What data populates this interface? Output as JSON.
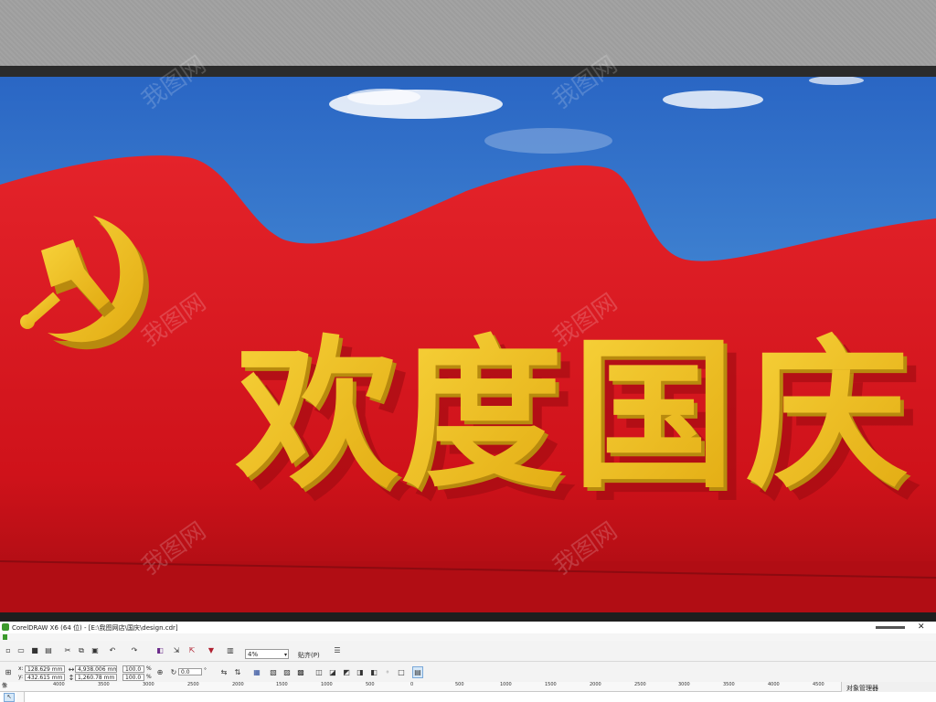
{
  "artwork": {
    "headline": [
      "欢",
      "度",
      "国",
      "庆"
    ],
    "emblem_icon": "hammer-and-sickle-icon",
    "colors": {
      "sky": "#3a7fd0",
      "banner_red": "#d3121b",
      "gold": "#f2c21e",
      "gold_shadow": "#b88a0e"
    }
  },
  "watermark": {
    "text": "我图网"
  },
  "app": {
    "window_title": "CorelDRAW X6 (64 位) - [E:\\我图网店\\国庆\\design.cdr]",
    "toolbar": {
      "zoom_value": "4%",
      "snap_label": "贴齐(P)"
    },
    "property_bar": {
      "x_label": "x:",
      "x_value": "128.629 mm",
      "y_label": "y:",
      "y_value": "432.615 mm",
      "width_value": "4,938.006 mm",
      "height_value": "1,260.78 mm",
      "scale_x": "100.0",
      "scale_y": "100.0",
      "percent": "%",
      "rotation": "0.0",
      "degree": "°"
    },
    "ruler": {
      "corner": "像",
      "ticks": [
        "4000",
        "3500",
        "3000",
        "2500",
        "2000",
        "1500",
        "1000",
        "500",
        "0",
        "500",
        "1000",
        "1500",
        "2000",
        "2500",
        "3000",
        "3500",
        "4000",
        "4500"
      ]
    },
    "docker": {
      "title": "对象管理器",
      "layer_label": "页 1"
    }
  }
}
